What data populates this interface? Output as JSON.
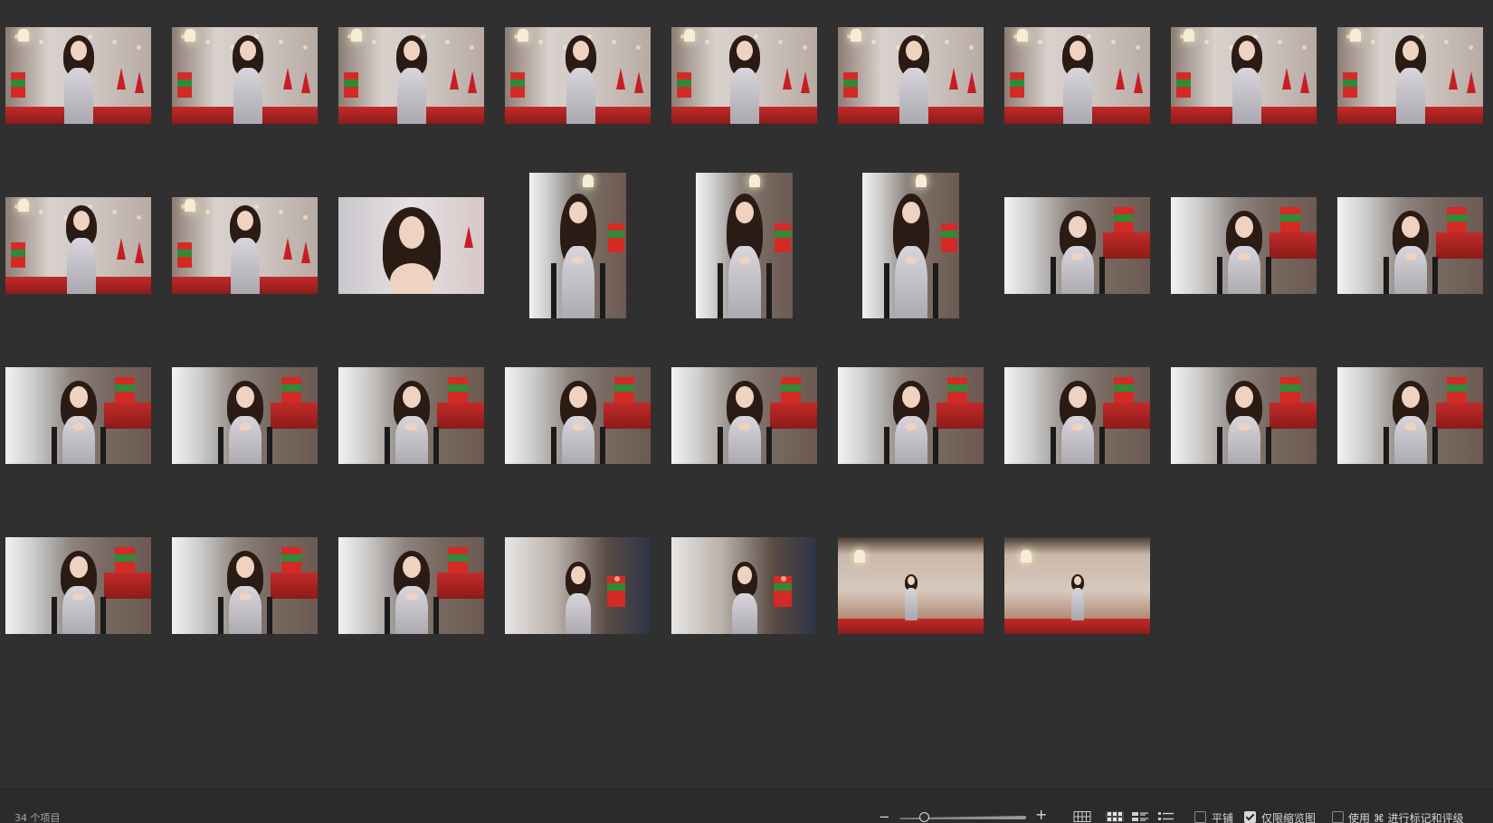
{
  "statusbar": {
    "item_count": "34 个项目",
    "zoom_minus": "−",
    "zoom_plus": "+",
    "tile_label": "平铺",
    "thumbs_only_label": "仅限缩览图",
    "rating_label": "使用 ⌘ 进行标记和评级",
    "tile_checked": false,
    "thumbs_only_checked": true,
    "rating_checked": false
  },
  "icons": {
    "zoom_out": "minus-icon",
    "zoom_in": "plus-icon",
    "view_large": "large-grid-icon",
    "view_grid": "grid-icon",
    "view_strip": "strip-icon",
    "view_list": "list-icon"
  },
  "thumbnails": [
    {
      "scene": "standing",
      "orient": "landscape"
    },
    {
      "scene": "standing",
      "orient": "landscape"
    },
    {
      "scene": "standing",
      "orient": "landscape"
    },
    {
      "scene": "standing",
      "orient": "landscape"
    },
    {
      "scene": "standing",
      "orient": "landscape"
    },
    {
      "scene": "standing",
      "orient": "landscape"
    },
    {
      "scene": "standing",
      "orient": "landscape"
    },
    {
      "scene": "standing",
      "orient": "landscape"
    },
    {
      "scene": "standing",
      "orient": "landscape"
    },
    {
      "scene": "standing",
      "orient": "landscape"
    },
    {
      "scene": "standing",
      "orient": "landscape"
    },
    {
      "scene": "closeup",
      "orient": "landscape"
    },
    {
      "scene": "seated",
      "orient": "portrait"
    },
    {
      "scene": "seated",
      "orient": "portrait"
    },
    {
      "scene": "seated",
      "orient": "portrait"
    },
    {
      "scene": "seated",
      "orient": "landscape"
    },
    {
      "scene": "seated",
      "orient": "landscape"
    },
    {
      "scene": "seated",
      "orient": "landscape"
    },
    {
      "scene": "seated",
      "orient": "landscape"
    },
    {
      "scene": "seated",
      "orient": "landscape"
    },
    {
      "scene": "seated",
      "orient": "landscape"
    },
    {
      "scene": "seated",
      "orient": "landscape"
    },
    {
      "scene": "seated",
      "orient": "landscape"
    },
    {
      "scene": "seated",
      "orient": "landscape"
    },
    {
      "scene": "seated",
      "orient": "landscape"
    },
    {
      "scene": "seated",
      "orient": "landscape"
    },
    {
      "scene": "seated",
      "orient": "landscape"
    },
    {
      "scene": "seated",
      "orient": "landscape"
    },
    {
      "scene": "seated",
      "orient": "landscape"
    },
    {
      "scene": "seated",
      "orient": "landscape"
    },
    {
      "scene": "room",
      "orient": "landscape"
    },
    {
      "scene": "room",
      "orient": "landscape"
    },
    {
      "scene": "wide",
      "orient": "landscape"
    },
    {
      "scene": "wide",
      "orient": "landscape"
    }
  ]
}
